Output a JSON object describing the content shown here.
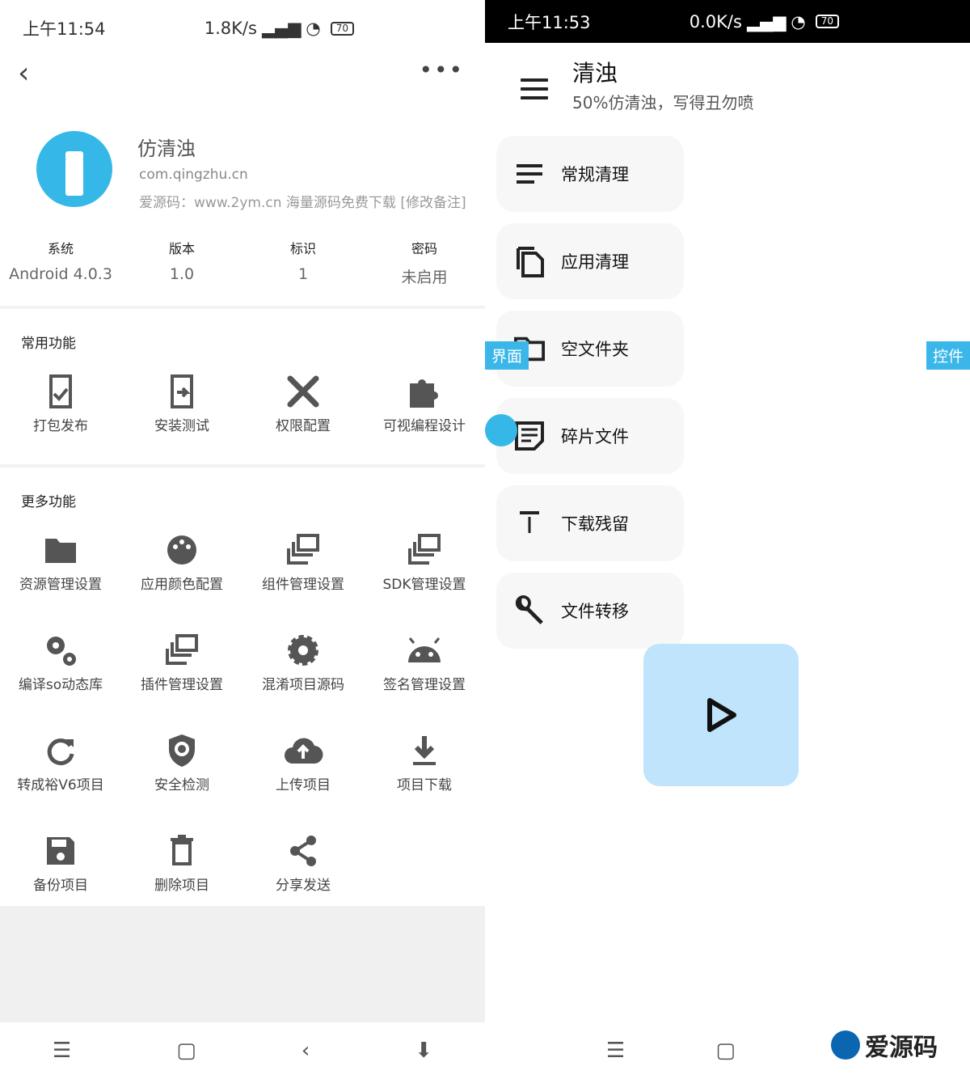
{
  "left": {
    "status": {
      "time": "上午11:54",
      "speed": "1.8K/s",
      "battery": "70"
    },
    "app": {
      "name": "仿清浊",
      "package": "com.qingzhu.cn",
      "note": "爱源码：www.2ym.cn 海量源码免费下载 [修改备注]"
    },
    "stats": [
      {
        "k": "系统",
        "v": "Android 4.0.3"
      },
      {
        "k": "版本",
        "v": "1.0"
      },
      {
        "k": "标识",
        "v": "1"
      },
      {
        "k": "密码",
        "v": "未启用"
      }
    ],
    "common_title": "常用功能",
    "common": [
      {
        "label": "打包发布",
        "icon": "package-icon"
      },
      {
        "label": "安装测试",
        "icon": "install-icon"
      },
      {
        "label": "权限配置",
        "icon": "tools-icon"
      },
      {
        "label": "可视编程设计",
        "icon": "puzzle-icon"
      }
    ],
    "more_title": "更多功能",
    "more": [
      {
        "label": "资源管理设置",
        "icon": "folder-icon"
      },
      {
        "label": "应用颜色配置",
        "icon": "palette-icon"
      },
      {
        "label": "组件管理设置",
        "icon": "layers-icon"
      },
      {
        "label": "SDK管理设置",
        "icon": "layers-icon"
      },
      {
        "label": "编译so动态库",
        "icon": "gears-icon"
      },
      {
        "label": "插件管理设置",
        "icon": "layers-icon"
      },
      {
        "label": "混淆项目源码",
        "icon": "gear-icon"
      },
      {
        "label": "签名管理设置",
        "icon": "android-icon"
      },
      {
        "label": "转成裕V6项目",
        "icon": "refresh-icon"
      },
      {
        "label": "安全检测",
        "icon": "shield-icon"
      },
      {
        "label": "上传项目",
        "icon": "cloud-upload-icon"
      },
      {
        "label": "项目下载",
        "icon": "download-icon"
      },
      {
        "label": "备份项目",
        "icon": "save-icon"
      },
      {
        "label": "删除项目",
        "icon": "trash-icon"
      },
      {
        "label": "分享发送",
        "icon": "share-icon"
      }
    ]
  },
  "right": {
    "status": {
      "time": "上午11:53",
      "speed": "0.0K/s",
      "battery": "70"
    },
    "title": "清浊",
    "subtitle": "50%仿清浊，写得丑勿喷",
    "tiles": [
      {
        "label": "常规清理",
        "icon": "lines-icon"
      },
      {
        "label": "应用清理",
        "icon": "copy-icon"
      },
      {
        "label": "空文件夹",
        "icon": "folder-outline-icon"
      },
      {
        "label": "碎片文件",
        "icon": "note-icon"
      },
      {
        "label": "下载残留",
        "icon": "download-line-icon"
      },
      {
        "label": "文件转移",
        "icon": "wrench-icon"
      }
    ],
    "tag_left": "界面",
    "tag_right": "控件",
    "watermark": "爱源码"
  }
}
